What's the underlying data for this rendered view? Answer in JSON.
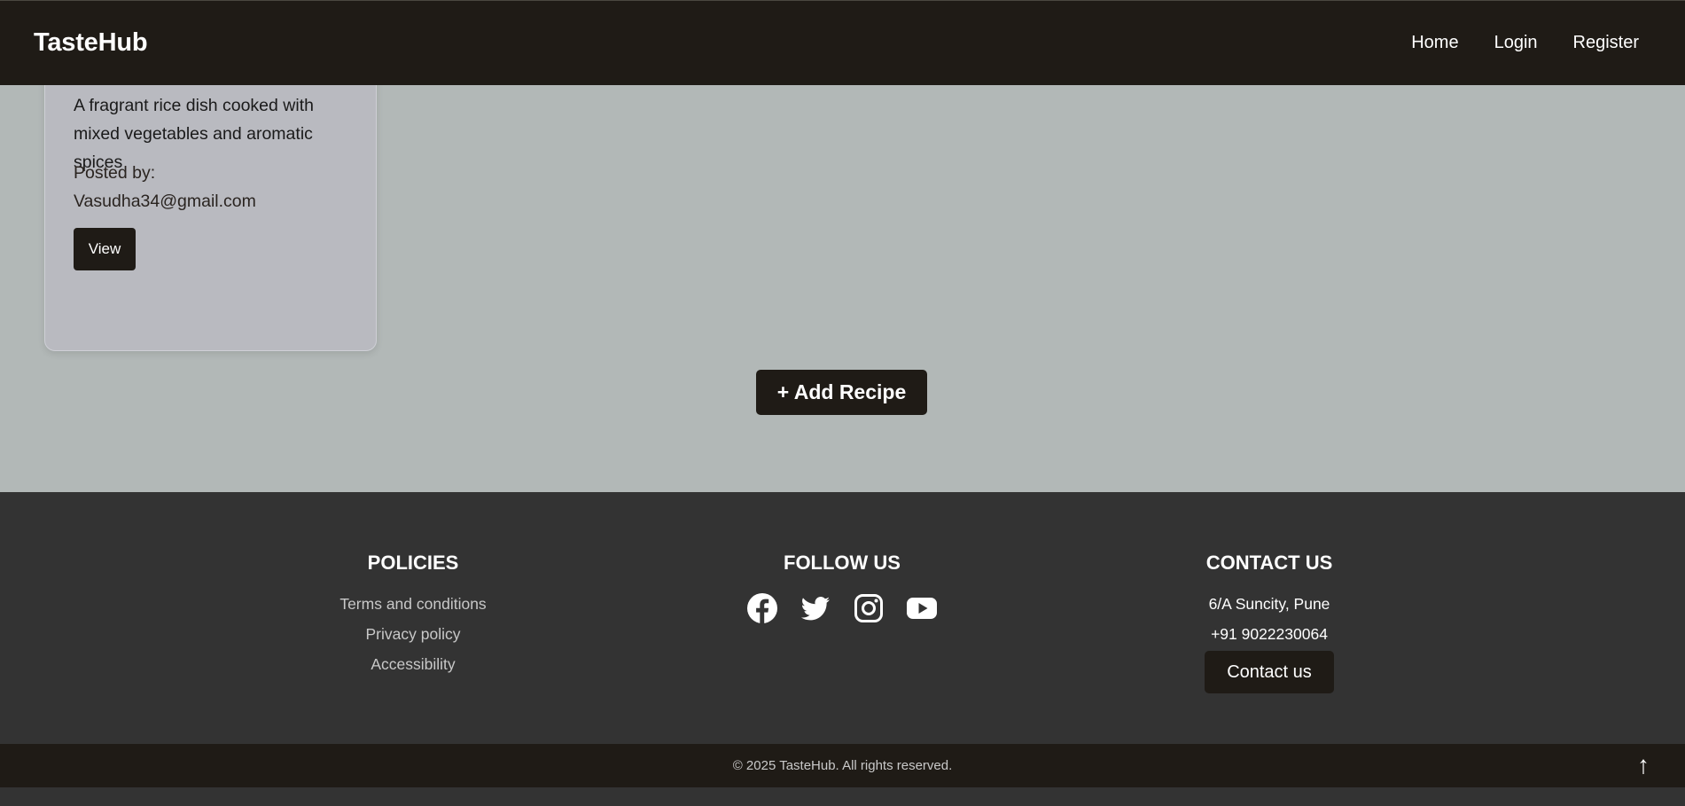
{
  "header": {
    "brand": "TasteHub",
    "nav": [
      "Home",
      "Login",
      "Register"
    ]
  },
  "recipe_card": {
    "description": "A fragrant rice dish cooked with mixed vegetables and aromatic spices",
    "posted_by": "Posted by: Vasudha34@gmail.com",
    "view_label": "View"
  },
  "add_recipe_label": "+ Add Recipe",
  "footer": {
    "policies": {
      "heading": "POLICIES",
      "links": [
        "Terms and conditions",
        "Privacy policy",
        "Accessibility"
      ]
    },
    "follow": {
      "heading": "FOLLOW US",
      "icons": [
        "facebook-icon",
        "twitter-icon",
        "instagram-icon",
        "youtube-icon"
      ]
    },
    "contact": {
      "heading": "CONTACT US",
      "address": "6/A Suncity, Pune",
      "phone": "+91 9022230064",
      "button_label": "Contact us"
    }
  },
  "copyright": "© 2025 TasteHub. All rights reserved.",
  "scroll_top_symbol": "↑",
  "colors": {
    "header_bg": "#1f1b16",
    "main_bg": "#b2b8b7",
    "card_bg": "#b9bac0",
    "footer_bg": "#333333"
  }
}
